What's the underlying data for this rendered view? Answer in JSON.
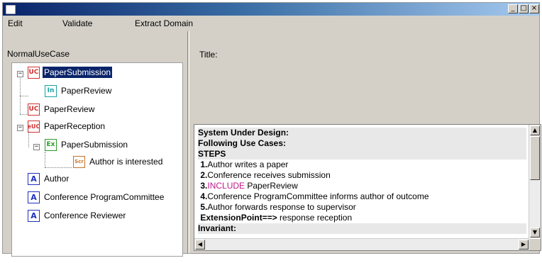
{
  "window": {
    "buttons": {
      "minimize": "_",
      "maximize": "□",
      "close": "×"
    }
  },
  "menu": {
    "items": [
      "Edit",
      "Validate",
      "Extract Domain"
    ]
  },
  "tree": {
    "title": "NormalUseCase",
    "nodes": [
      {
        "icon": "UC",
        "label": "PaperSubmission",
        "selected": true
      },
      {
        "icon": "In",
        "label": "PaperReview"
      },
      {
        "icon": "UC",
        "label": "PaperReview"
      },
      {
        "icon": "eUC",
        "label": "PaperReception"
      },
      {
        "icon": "Ex",
        "label": "PaperSubmission"
      },
      {
        "icon": "Scr",
        "label": "Author is interested"
      },
      {
        "icon": "A",
        "label": "Author"
      },
      {
        "icon": "A",
        "label": "Conference ProgramCommittee"
      },
      {
        "icon": "A",
        "label": "Conference Reviewer"
      }
    ]
  },
  "details": {
    "title_label": "Title:",
    "lines": {
      "system_under_design": "System Under Design:",
      "following_use_cases": "Following Use Cases:",
      "steps": "STEPS",
      "s1_num": "1.",
      "s1": "Author writes a paper",
      "s2_num": "2.",
      "s2": "Conference receives submission",
      "s3_num": "3.",
      "s3_kw": "INCLUDE",
      "s3": " PaperReview",
      "s4_num": "4.",
      "s4": "Conference ProgramCommittee informs author of outcome",
      "s5_num": "5.",
      "s5": "Author forwards response to supervisor",
      "ext_kw": "ExtensionPoint",
      "ext_arrow": "==>",
      "ext": " response reception",
      "invariant": "Invariant:"
    }
  },
  "colors": {
    "titlebar_start": "#0a246a",
    "selection": "#0a246a",
    "include": "#c0188a"
  }
}
